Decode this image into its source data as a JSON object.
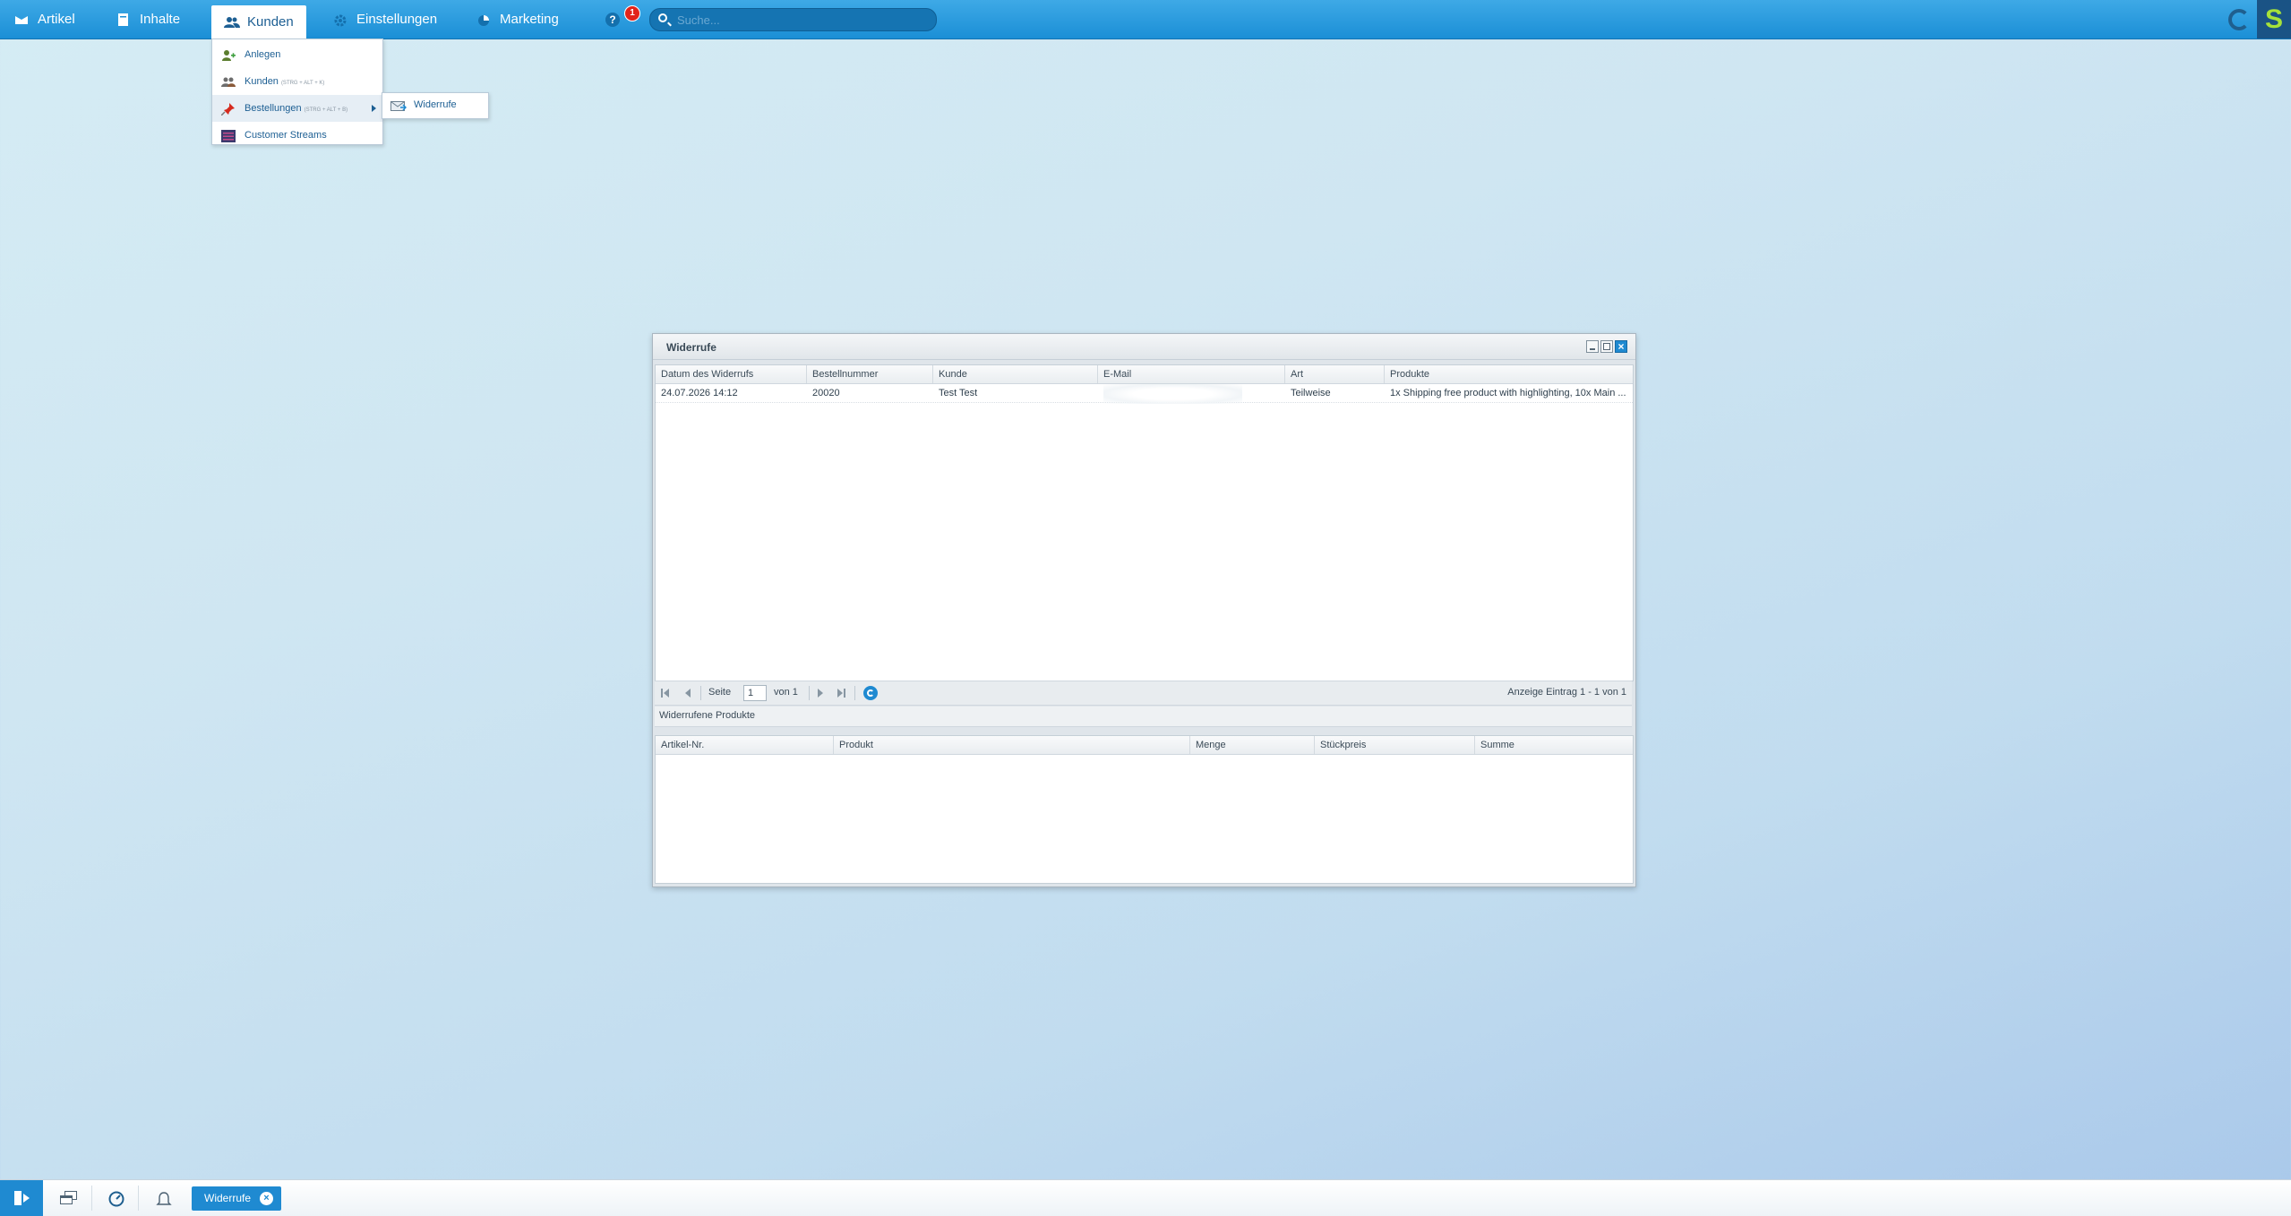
{
  "topbar": {
    "nav": [
      {
        "label": "Artikel",
        "icon": "articles-icon"
      },
      {
        "label": "Inhalte",
        "icon": "content-icon"
      },
      {
        "label": "Kunden",
        "icon": "customers-icon",
        "active": true
      },
      {
        "label": "Einstellungen",
        "icon": "gear-icon"
      },
      {
        "label": "Marketing",
        "icon": "marketing-icon"
      }
    ],
    "help_icon": "?",
    "notification_count": "1",
    "search": {
      "placeholder": "Suche...",
      "value": ""
    },
    "brand_logo": "S"
  },
  "customers_menu": {
    "items": [
      {
        "label": "Anlegen",
        "shortcut": "",
        "icon": "add-customer-icon"
      },
      {
        "label": "Kunden",
        "shortcut": "(STRG + ALT + K)",
        "icon": "customers-list-icon"
      },
      {
        "label": "Bestellungen",
        "shortcut": "(STRG + ALT + B)",
        "icon": "pin-icon",
        "has_submenu": true
      },
      {
        "label": "Customer Streams",
        "shortcut": "",
        "icon": "streams-icon"
      }
    ],
    "submenu": {
      "label": "Widerrufe",
      "icon": "withdrawal-icon"
    }
  },
  "window": {
    "title": "Widerrufe",
    "withdrawals_grid": {
      "columns": [
        "Datum des Widerrufs",
        "Bestellnummer",
        "Kunde",
        "E-Mail",
        "Art",
        "Produkte"
      ],
      "rows": [
        {
          "date": "24.07.2026 14:12",
          "order_number": "20020",
          "customer": "Test Test",
          "email": "",
          "type": "Teilweise",
          "products": "1x Shipping free product with highlighting, 10x Main ..."
        }
      ]
    },
    "pager": {
      "page_label": "Seite",
      "page_value": "1",
      "of_label": "von 1",
      "display_info": "Anzeige Eintrag 1 - 1 von 1"
    },
    "products_section_title": "Widerrufene Produkte",
    "products_grid": {
      "columns": [
        "Artikel-Nr.",
        "Produkt",
        "Menge",
        "Stückpreis",
        "Summe"
      ],
      "rows": []
    }
  },
  "bottombar": {
    "task_label": "Widerrufe",
    "task_close": "×"
  },
  "colors": {
    "topbar": "#1b8fd6",
    "accent": "#1f8ad1",
    "badge": "#e2231a",
    "brand_green": "#a6e23a"
  }
}
